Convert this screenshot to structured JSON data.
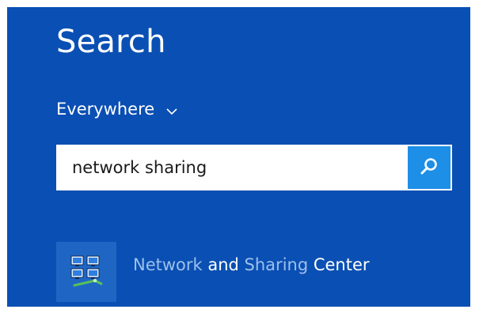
{
  "panel": {
    "title": "Search",
    "scope_label": "Everywhere",
    "accent_color": "#0a4fb3",
    "search_button_color": "#1d8fe6"
  },
  "search": {
    "value": "network sharing",
    "icon": "search-icon"
  },
  "results": [
    {
      "icon": "network-sharing-center-icon",
      "label_parts": [
        {
          "text": "Network",
          "match": true
        },
        {
          "text": " and ",
          "match": false
        },
        {
          "text": "Sharing",
          "match": true
        },
        {
          "text": " Center",
          "match": false
        }
      ]
    }
  ]
}
